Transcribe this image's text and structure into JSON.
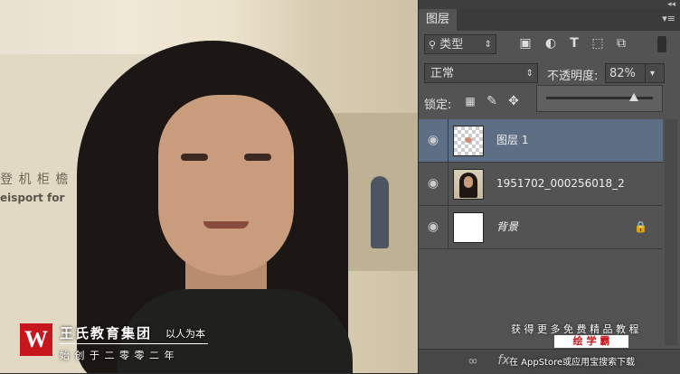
{
  "panel": {
    "collapse_icon": "double-chevron-icon",
    "menu_icon": "panel-menu-icon",
    "tab_label": "图层",
    "filter": {
      "icon": "search-icon",
      "value": "类型",
      "filter_icons": [
        "image-filter-icon",
        "adjustment-filter-icon",
        "type-filter-icon",
        "shape-filter-icon",
        "smart-object-filter-icon"
      ]
    },
    "blend_mode": "正常",
    "opacity_label": "不透明度:",
    "opacity_value": "82%",
    "opacity_level": 0.82,
    "lock_label": "锁定:",
    "lock_icons": [
      "lock-transparent-icon",
      "lock-paint-icon",
      "lock-move-icon"
    ],
    "layers": [
      {
        "name": "图层 1",
        "selected": true,
        "thumbnail": "transparent-checker"
      },
      {
        "name": "1951702_000256018_2",
        "selected": false,
        "thumbnail": "portrait"
      },
      {
        "name": "背景",
        "selected": false,
        "thumbnail": "white",
        "locked": true
      }
    ],
    "bottom_icons": [
      "link-icon",
      "fx-icon"
    ]
  },
  "photo": {
    "sign_text": "登 机 柜 檐",
    "sign_text_2": "eisport for"
  },
  "watermark": {
    "logo_letter": "W",
    "company": "王氏教育集团",
    "slogan": "以人为本",
    "founded": "始 创 于 二 零 零 二 年",
    "promo_line": "获 得 更 多 免 费 精 品 教 程",
    "promo_brand": "绘 学 霸",
    "promo_store": "在 AppStore或应用宝搜索下载"
  },
  "colors": {
    "panel_bg": "#535353",
    "selected_layer": "#5d6e85",
    "brand_red": "#c8161d"
  }
}
